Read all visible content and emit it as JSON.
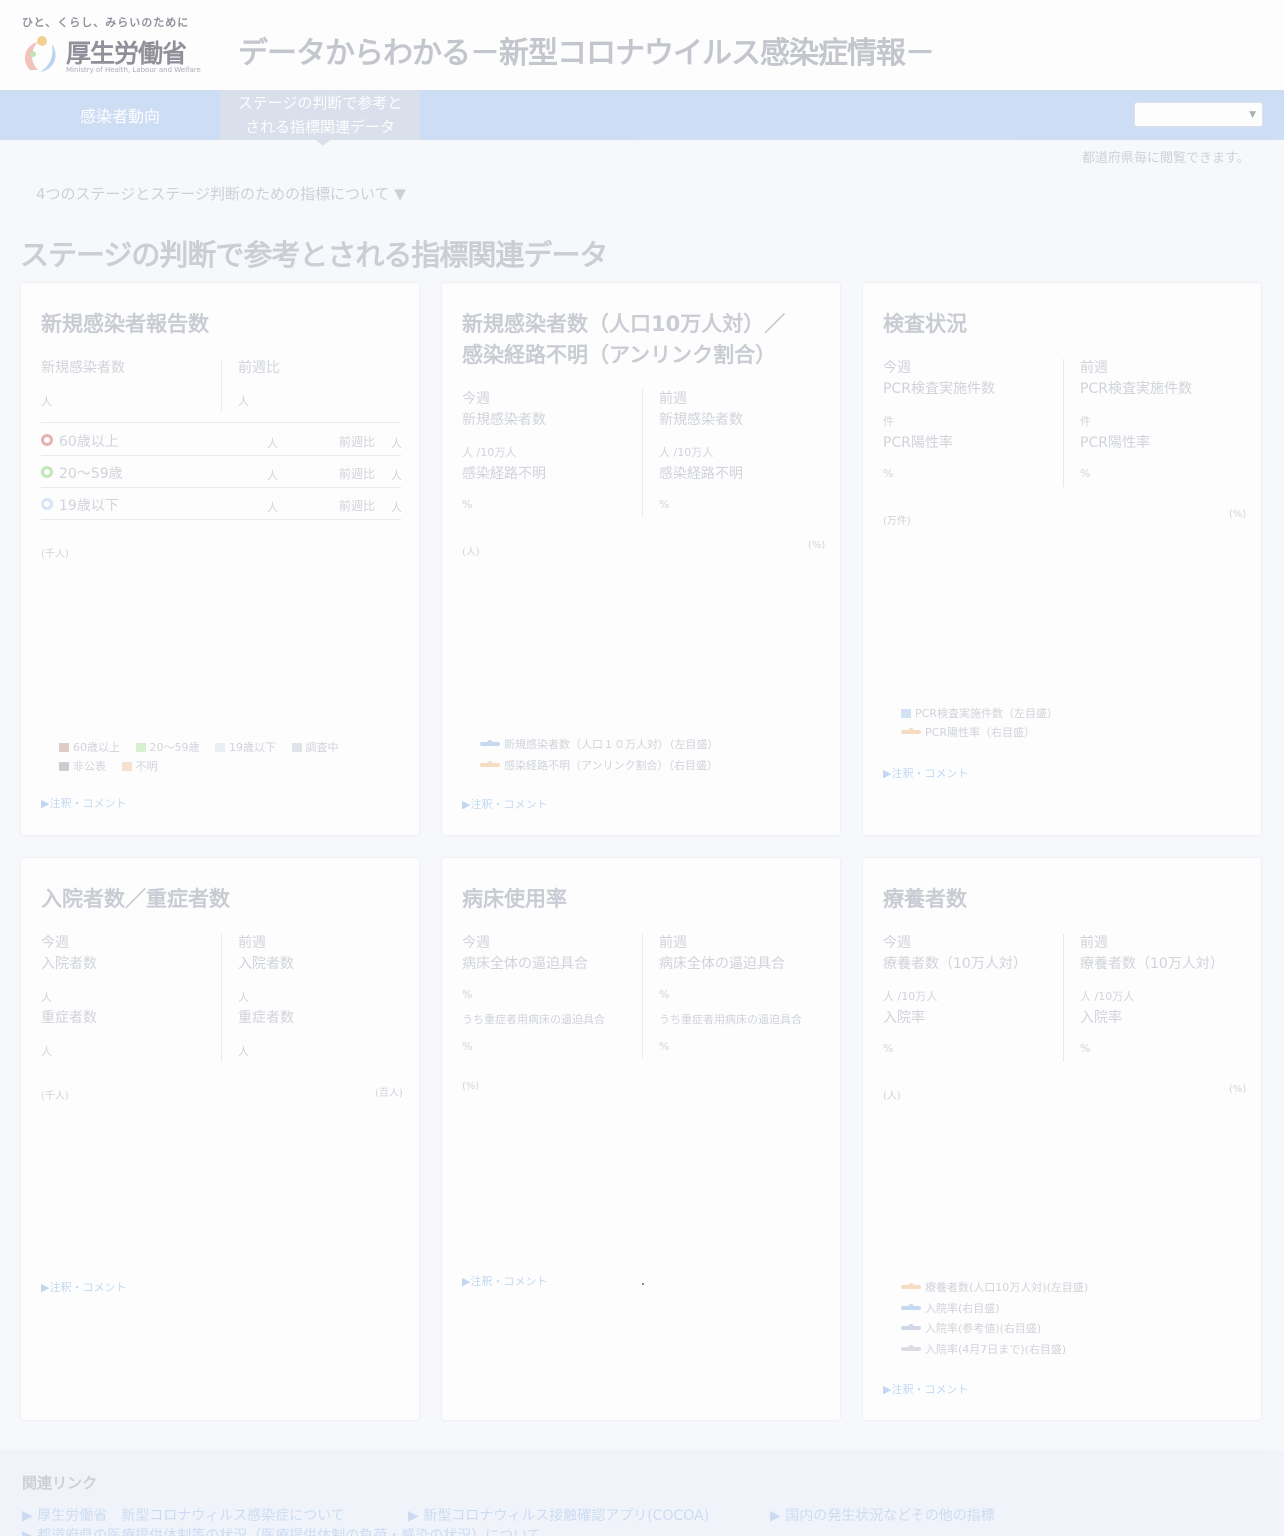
{
  "header": {
    "logo_tagline": "ひと、くらし、みらいのために",
    "logo_name": "厚生労働省",
    "logo_english": "Ministry of Health, Labour and Welfare",
    "site_title": "データからわかる－新型コロナウイルス感染症情報－"
  },
  "nav": {
    "tab1": "感染者動向",
    "tab2_line1": "ステージの判断で参考と",
    "tab2_line2": "される指標関連データ",
    "select_value": ""
  },
  "pref_note": "都道府県毎に閲覧できます。",
  "stage_toggle": "4つのステージとステージ判断のための指標について ▼",
  "page_title": "ステージの判断で参考とされる指標関連データ",
  "common": {
    "this_week": "今週",
    "last_week": "前週",
    "note_link": "▶注釈・コメント",
    "unit_person": "人",
    "unit_per100k": "人 /10万人",
    "unit_percent": "%",
    "unit_case": "件",
    "prev_ratio": "前週比"
  },
  "card1": {
    "title": "新規感染者報告数",
    "stat1": "新規感染者数",
    "stat2": "前週比",
    "ages": [
      {
        "label": "60歳以上",
        "color": "#e3a6a0"
      },
      {
        "label": "20～59歳",
        "color": "#b7e3a8"
      },
      {
        "label": "19歳以下",
        "color": "#cfe2f7"
      }
    ],
    "axis_left": "(千人)",
    "legend": [
      {
        "label": "60歳以上",
        "color": "#dcc0bb"
      },
      {
        "label": "20～59歳",
        "color": "#cfeec6"
      },
      {
        "label": "19歳以下",
        "color": "#e6ebf3"
      },
      {
        "label": "調査中",
        "color": "#dcdfe4"
      },
      {
        "label": "非公表",
        "color": "#c2c4c8"
      },
      {
        "label": "不明",
        "color": "#f6dcc4"
      }
    ]
  },
  "card2": {
    "title_line1": "新規感染者数（人口10万人対）／",
    "title_line2": "感染経路不明（アンリンク割合）",
    "new_cases": "新規感染者数",
    "unlinked": "感染経路不明",
    "axis_left": "(人)",
    "axis_right": "(%)",
    "legend": [
      {
        "label": "新規感染者数（人口１０万人対）（左目盛）",
        "color": "#bcd3ef"
      },
      {
        "label": "感染経路不明（アンリンク割合）（右目盛）",
        "color": "#f7d7b8"
      }
    ]
  },
  "card3": {
    "title": "検査状況",
    "pcr_count": "PCR検査実施件数",
    "pcr_rate": "PCR陽性率",
    "axis_left": "(万件)",
    "axis_right": "(%)",
    "legend": [
      {
        "label": "PCR検査実施件数（左目盛）",
        "color": "#cbdcf2"
      },
      {
        "label": "PCR陽性率（右目盛）",
        "color": "#f7d7b8"
      }
    ]
  },
  "card4": {
    "title": "入院者数／重症者数",
    "inpatients": "入院者数",
    "severe": "重症者数",
    "axis_left": "(千人)",
    "axis_right": "(百人)"
  },
  "card5": {
    "title": "病床使用率",
    "bed_rate": "病床全体の逼迫具合",
    "severe_bed_rate": "うち重症者用病床の逼迫具合",
    "axis_left": "(%)"
  },
  "card6": {
    "title": "療養者数",
    "patients": "療養者数（10万人対）",
    "hosp_rate": "入院率",
    "axis_left": "(人)",
    "axis_right": "(%)",
    "legend": [
      {
        "label": "療養者数(人口10万人対)(左目盛)",
        "color": "#f7d7b8"
      },
      {
        "label": "入院率(右目盛)",
        "color": "#bcd3ef"
      },
      {
        "label": "入院率(参考値)(右目盛)",
        "color": "#c9d2e0"
      },
      {
        "label": "入院率(4月7日まで)(右目盛)",
        "color": "#d5d8dd"
      }
    ]
  },
  "footer": {
    "title": "関連リンク",
    "links": [
      "▶ 厚生労働省　新型コロナウィルス感染症について",
      "▶ 新型コロナウィルス接触確認アプリ(COCOA)",
      "▶ 国内の発生状況などその他の指標",
      "▶ 都道府県の医療提供体制等の状況（医療提供体制の負荷・感染の状況）について"
    ]
  }
}
